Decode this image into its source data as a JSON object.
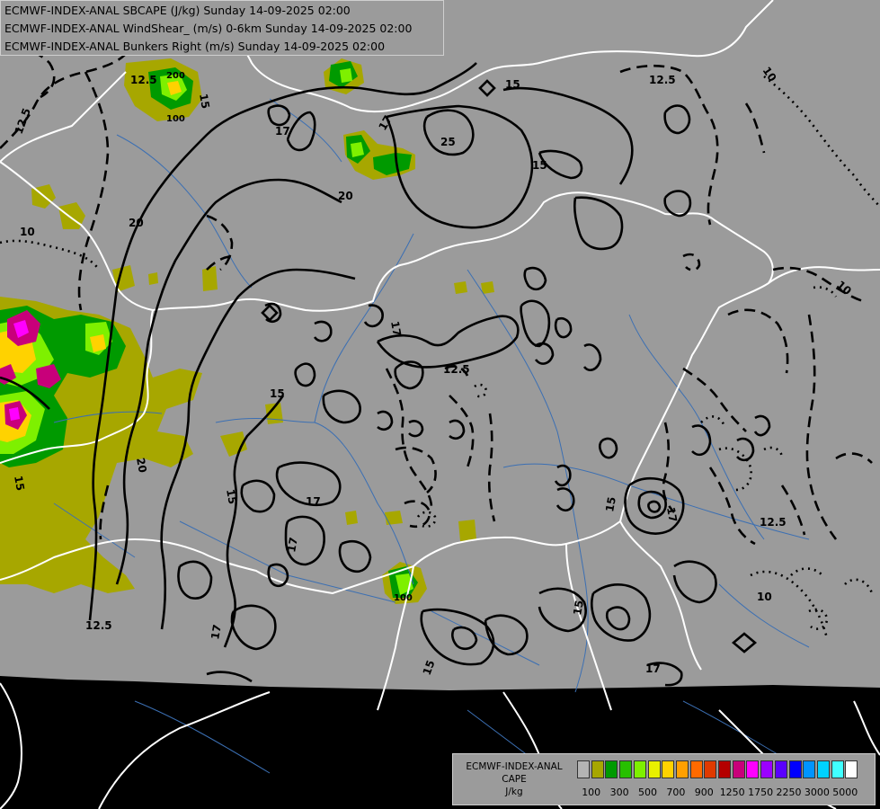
{
  "titles": [
    "ECMWF-INDEX-ANAL SBCAPE (J/kg) Sunday 14-09-2025 02:00",
    "ECMWF-INDEX-ANAL WindShear_ (m/s) 0-6km Sunday 14-09-2025 02:00",
    "ECMWF-INDEX-ANAL Bunkers Right (m/s) Sunday 14-09-2025 02:00"
  ],
  "legend": {
    "line1": "ECMWF-INDEX-ANAL",
    "line2": "CAPE",
    "line3": "J/kg",
    "colors": [
      "#b4b4b4",
      "#a7a700",
      "#009a00",
      "#27c000",
      "#7ef000",
      "#e8f000",
      "#ffd200",
      "#ffa000",
      "#ff6a00",
      "#e03a00",
      "#b40000",
      "#c8007a",
      "#ff00ff",
      "#9b00ff",
      "#5a00ff",
      "#0000ff",
      "#0094ff",
      "#00d2ff",
      "#40ffff",
      "#ffffff"
    ],
    "ticks": [
      "100",
      "300",
      "500",
      "700",
      "900",
      "1250",
      "1750",
      "2250",
      "3000",
      "5000"
    ]
  },
  "contour_labels": [
    "12.5",
    "200",
    "100",
    "15",
    "17",
    "20",
    "25",
    "12.5",
    "10",
    "15",
    "17",
    "20",
    "15",
    "17",
    "12.5",
    "15",
    "17",
    "10",
    "15",
    "12.5",
    "10",
    "15",
    "17",
    "12.5",
    "17",
    "20",
    "15",
    "100",
    "15",
    "17",
    "12.5",
    "17",
    "15",
    "10"
  ]
}
